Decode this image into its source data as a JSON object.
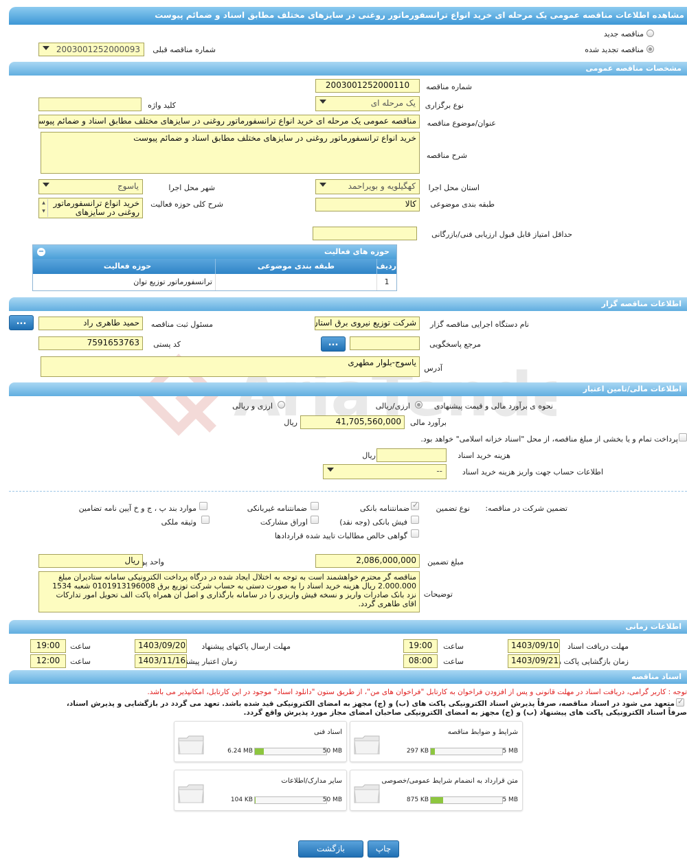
{
  "page_title": "مشاهده اطلاعات مناقصه عمومی یک مرحله ای خرید انواع ترانسفورماتور روغنی در سایزهای مختلف مطابق اسناد و ضمائم پیوست",
  "tender_type": {
    "option_new": "مناقصه جدید",
    "option_renewed": "مناقصه تجدید شده",
    "prev_number_label": "شماره مناقصه قبلی",
    "prev_number_value": "2003001252000093"
  },
  "general": {
    "section_title": "مشخصات مناقصه عمومی",
    "number_label": "شماره مناقصه",
    "number_value": "2003001252000110",
    "holding_type_label": "نوع برگزاری",
    "holding_type_value": "یک مرحله ای",
    "keyword_label": "کلید واژه",
    "keyword_value": "",
    "subject_label": "عنوان/موضوع مناقصه",
    "subject_value": "مناقصه عمومی یک مرحله ای خرید انواع ترانسفورماتور روغنی در سایزهای مختلف مطابق اسناد و ضمائم پیوست",
    "description_label": "شرح مناقصه",
    "description_value": "خرید انواع ترانسفورماتور روغنی در سایزهای مختلف مطابق اسناد و ضمائم پیوست",
    "province_label": "استان محل اجرا",
    "province_value": "کهگیلویه و بویراحمد",
    "city_label": "شهر محل اجرا",
    "city_value": "یاسوج",
    "category_label": "طبقه بندی موضوعی",
    "category_value": "کالا",
    "scope_label": "شرح کلی حوزه فعالیت",
    "scope_value": "خرید انواع ترانسفورماتور روغنی در سایزهای",
    "min_score_label": "حداقل امتیاز قابل قبول ارزیابی فنی/بازرگانی",
    "min_score_value": ""
  },
  "activity_grid": {
    "title": "حوزه های فعالیت",
    "col_row": "ردیف",
    "col_category": "طبقه بندی موضوعی",
    "col_field": "حوزه فعالیت",
    "rows": [
      {
        "row": "1",
        "category": "",
        "field": "ترانسفورماتور توزیع توان"
      }
    ]
  },
  "organizer": {
    "section_title": "اطلاعات مناقصه گزار",
    "org_label": "نام دستگاه اجرایی مناقصه گزار",
    "org_value": "شرکت توزیع نیروی برق استان",
    "registrar_label": "مسئول ثبت مناقصه",
    "registrar_value": "حمید طاهری راد",
    "dots": "...",
    "ref_label": "مرجع پاسخگویی",
    "ref_value": "",
    "postal_label": "کد پستی",
    "postal_value": "7591653763",
    "address_label": "آدرس",
    "address_value": "یاسوج-بلوار مطهری"
  },
  "finance": {
    "section_title": "اطلاعات مالی/تامین اعتبار",
    "method_label": "نحوه ی برآورد مالی و قیمت پیشنهادی",
    "method_rial": "ارزی/ریالی",
    "method_fx": "ارزی و ریالی",
    "estimate_label": "برآورد مالی",
    "estimate_value": "41,705,560,000",
    "currency": "ریال",
    "treasury_text": "پرداخت تمام و یا بخشی از مبلغ مناقصه، از محل \"اسناد خزانه اسلامی\" خواهد بود.",
    "doc_fee_label": "هزینه خرید اسناد",
    "doc_fee_value": "",
    "doc_fee_currency": "ریال",
    "account_label": "اطلاعات حساب جهت واریز هزینه خرید اسناد",
    "account_value": "--"
  },
  "guarantee": {
    "participation_label": "تضمین شرکت در مناقصه:",
    "type_label": "نوع تضمین",
    "opt_bank": "ضمانتنامه بانکی",
    "opt_nonbank": "ضمانتنامه غیربانکی",
    "opt_articles": "موارد بند پ ، ج و خ آیین نامه تضامین",
    "opt_cash": "فیش بانکی (وجه نقد)",
    "opt_bonds": "اوراق مشارکت",
    "opt_property": "وثیقه ملکی",
    "opt_receivables": "گواهی خالص مطالبات تایید شده قراردادها",
    "amount_label": "مبلغ تضمین",
    "amount_value": "2,086,000,000",
    "unit_label": "واحد پول",
    "unit_value": "ریال",
    "notes_label": "توضیحات",
    "notes_value": "مناقصه گر محترم خواهشمند است به توجه به اختلال ایجاد شده در درگاه پرداخت الکترونیکی سامانه ستادیران مبلغ 2.000.000 ریال هزینه خرید اسناد را به صورت دستی به حساب شرکت توزیع برق 0101913196008 شعبه 1534 نزد بانک صادرات واریز  و نسخه فیش واریزی را در سامانه بارگذاری و  اصل ان همراه پاکت الف تحویل امور تدارکات اقای طاهری گردد."
  },
  "timing": {
    "section_title": "اطلاعات زمانی",
    "doc_receive_label": "مهلت دریافت اسناد",
    "doc_receive_date": "1403/09/10",
    "doc_receive_time": "19:00",
    "send_label": "مهلت ارسال پاکتهای پیشنهاد",
    "send_date": "1403/09/20",
    "send_time": "19:00",
    "open_label": "زمان بازگشایی پاکت ها",
    "open_date": "1403/09/21",
    "open_time": "08:00",
    "validity_label": "زمان اعتبار پیشنهاد",
    "validity_date": "1403/11/16",
    "validity_time": "12:00",
    "time_label": "ساعت"
  },
  "documents": {
    "section_title": "اسناد مناقصه",
    "note": "توجه : کاربر گرامی، دریافت اسناد در مهلت قانونی و پس از افزودن فراخوان به کارتابل \"فراخوان های من\"، از طریق ستون \"دانلود اسناد\" موجود در این کارتابل، امکانپذیر می باشد.",
    "commit_line1": "متعهد می شود در اسناد مناقصه، صرفاً پذیرش اسناد الکترونیکی پاکت های (ب) و (ج) مجهز به امضای الکترونیکی قید شده باشد. تعهد می گردد در بازگشایی و پذیرش اسناد،",
    "commit_line2": "صرفاً اسناد الکترونیکی پاکت های پیشنهاد (ب) و (ج) مجهز به امضای الکترونیکی صاحبان امضای مجاز مورد پذیرش واقع گردد.",
    "files": [
      {
        "title": "شرایط و ضوابط مناقصه",
        "used": "297 KB",
        "max": "5 MB",
        "fill_pct": 6
      },
      {
        "title": "اسناد فنی",
        "used": "6.24 MB",
        "max": "50 MB",
        "fill_pct": 12.5
      },
      {
        "title": "متن قرارداد به انضمام شرایط عمومی/خصوصی",
        "used": "875 KB",
        "max": "5 MB",
        "fill_pct": 17
      },
      {
        "title": "سایر مدارک/اطلاعات",
        "used": "104 KB",
        "max": "50 MB",
        "fill_pct": 1
      }
    ]
  },
  "actions": {
    "print_label": "چاپ",
    "back_label": "بازگشت"
  },
  "watermark_text": "AriaTender.neT",
  "colors": {
    "header_blue": "#3d97d6",
    "field_yellow": "#fdfcc0",
    "red_note": "#e02020",
    "progress_green": "#8dc63f"
  }
}
